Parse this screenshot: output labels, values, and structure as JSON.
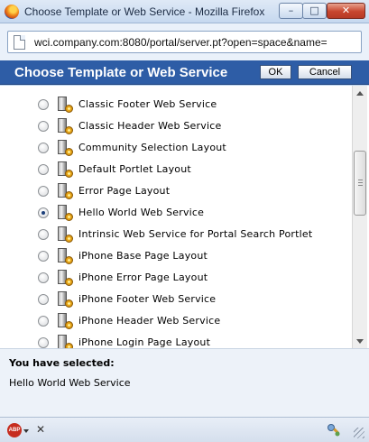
{
  "window": {
    "title": "Choose Template or Web Service - Mozilla Firefox",
    "minimize_glyph": "–",
    "maximize_glyph": "□",
    "close_glyph": "✕"
  },
  "urlbar": {
    "url": "wci.company.com:8080/portal/server.pt?open=space&name="
  },
  "dialog": {
    "title": "Choose Template or Web Service",
    "ok_label": "OK",
    "cancel_label": "Cancel"
  },
  "list": {
    "items": [
      {
        "label": "Classic Footer Web Service",
        "selected": false
      },
      {
        "label": "Classic Header Web Service",
        "selected": false
      },
      {
        "label": "Community Selection Layout",
        "selected": false
      },
      {
        "label": "Default Portlet Layout",
        "selected": false
      },
      {
        "label": "Error Page Layout",
        "selected": false
      },
      {
        "label": "Hello World Web Service",
        "selected": true
      },
      {
        "label": "Intrinsic Web Service for Portal Search Portlet",
        "selected": false
      },
      {
        "label": "iPhone Base Page Layout",
        "selected": false
      },
      {
        "label": "iPhone Error Page Layout",
        "selected": false
      },
      {
        "label": "iPhone Footer Web Service",
        "selected": false
      },
      {
        "label": "iPhone Header Web Service",
        "selected": false
      },
      {
        "label": "iPhone Login Page Layout",
        "selected": false
      }
    ]
  },
  "selection": {
    "heading": "You have selected:",
    "value": "Hello World Web Service"
  },
  "statusbar": {
    "abp_label": "ABP",
    "close_glyph": "✕"
  },
  "colors": {
    "dialog_header": "#2e5da6",
    "selection_panel": "#edf2f9"
  }
}
